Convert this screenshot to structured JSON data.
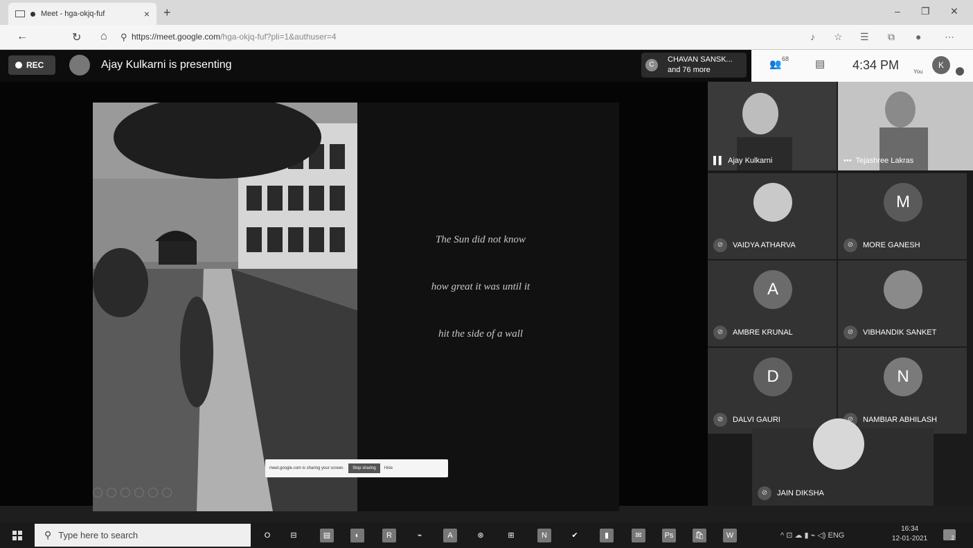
{
  "browser": {
    "tab_title": "Meet - hga-okjq-fuf",
    "tab_close": "×",
    "new_tab": "+",
    "url_host": "https://meet.google.com",
    "url_path": "/hga-okjq-fuf?pli=1&authuser=4",
    "win_min": "–",
    "win_max": "❐",
    "win_close": "✕"
  },
  "meet": {
    "rec_label": "REC",
    "presenting_text": "Ajay Kulkarni is presenting",
    "chip_initial": "C",
    "chip_line1": "CHAVAN SANSK...",
    "chip_line2": "and 76 more",
    "people_count": "68",
    "time": "4:34 PM",
    "you_label": "You",
    "self_initial": "K"
  },
  "slide": {
    "quote_lines": [
      "The Sun did not know",
      "how great it was until it",
      "hit the side of  a wall"
    ]
  },
  "share_bar": {
    "text": "meet.google.com is sharing your screen.",
    "stop_label": "Stop sharing",
    "hide_label": "Hide"
  },
  "video_tiles": [
    {
      "name": "Ajay Kulkarni",
      "indicator": "▌▌"
    },
    {
      "name": "Tejashree Lakras",
      "indicator": "•••"
    }
  ],
  "participants": [
    {
      "name": "VAIDYA ATHARVA",
      "initial": "",
      "color": "#c9c9c9"
    },
    {
      "name": "MORE GANESH",
      "initial": "M",
      "color": "#5a5a5a"
    },
    {
      "name": "AMBRE KRUNAL",
      "initial": "A",
      "color": "#6b6b6b"
    },
    {
      "name": "VIBHANDIK SANKET",
      "initial": "",
      "color": "#8a8a8a"
    },
    {
      "name": "DALVI GAURI",
      "initial": "D",
      "color": "#5f5f5f"
    },
    {
      "name": "NAMBIAR ABHILASH",
      "initial": "N",
      "color": "#7a7a7a"
    },
    {
      "name": "JAIN DIKSHA",
      "initial": "",
      "color": "#d8d8d8"
    }
  ],
  "taskbar": {
    "search_placeholder": "Type here to search",
    "apps": [
      "O",
      "⊟",
      "▤",
      "◐",
      "R",
      "⌁",
      "A",
      "⊛",
      "⊞",
      "N",
      "✔",
      "▮",
      "✉",
      "Ps",
      "🛍",
      "W"
    ],
    "tray_text": "^  ⊡  ☁  ▮  ⌁  ◁)  ENG",
    "clock_time": "16:34",
    "clock_date": "12-01-2021",
    "notif_count": "2"
  }
}
